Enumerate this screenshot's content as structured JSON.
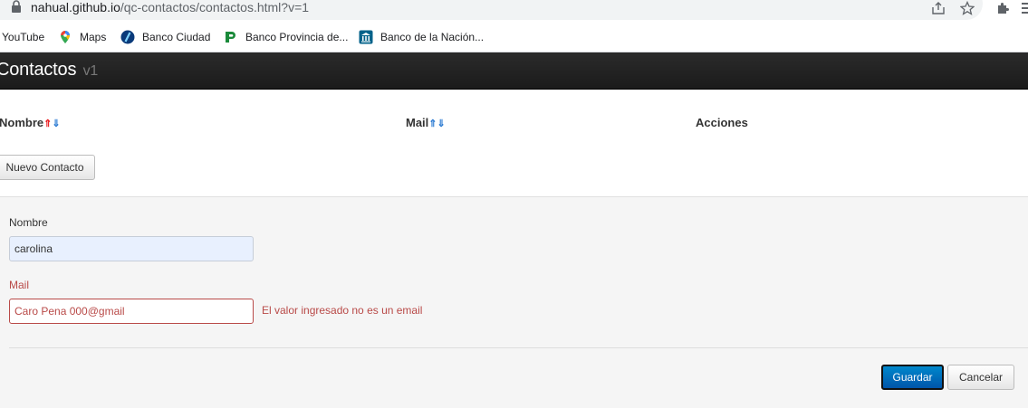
{
  "browser": {
    "url_host": "nahual.github.io",
    "url_path": "/qc-contactos/contactos.html?v=1"
  },
  "bookmarks": [
    {
      "label": "YouTube",
      "icon": "youtube-icon"
    },
    {
      "label": "Maps",
      "icon": "maps-pin-icon"
    },
    {
      "label": "Banco Ciudad",
      "icon": "banco-ciudad-icon"
    },
    {
      "label": "Banco Provincia de...",
      "icon": "banco-provincia-icon"
    },
    {
      "label": "Banco de la Nación...",
      "icon": "banco-nacion-icon"
    }
  ],
  "app": {
    "title": "Contactos",
    "version": "v1"
  },
  "table": {
    "columns": [
      {
        "label": "Nombre",
        "sort_up": "⇑",
        "sort_down": "⇓"
      },
      {
        "label": "Mail",
        "sort_up": "⇑",
        "sort_down": "⇓"
      },
      {
        "label": "Acciones"
      }
    ],
    "active_sort_color": "#e8171b",
    "sort_color": "#2a7ad2"
  },
  "new_contact_button": "Nuevo Contacto",
  "form": {
    "name_label": "Nombre",
    "name_value": "carolina",
    "mail_label": "Mail",
    "mail_value": "Caro Pena 000@gmail",
    "mail_error": "El valor ingresado no es un email",
    "error_color": "#b94a48",
    "save_label": "Guardar",
    "cancel_label": "Cancelar"
  }
}
